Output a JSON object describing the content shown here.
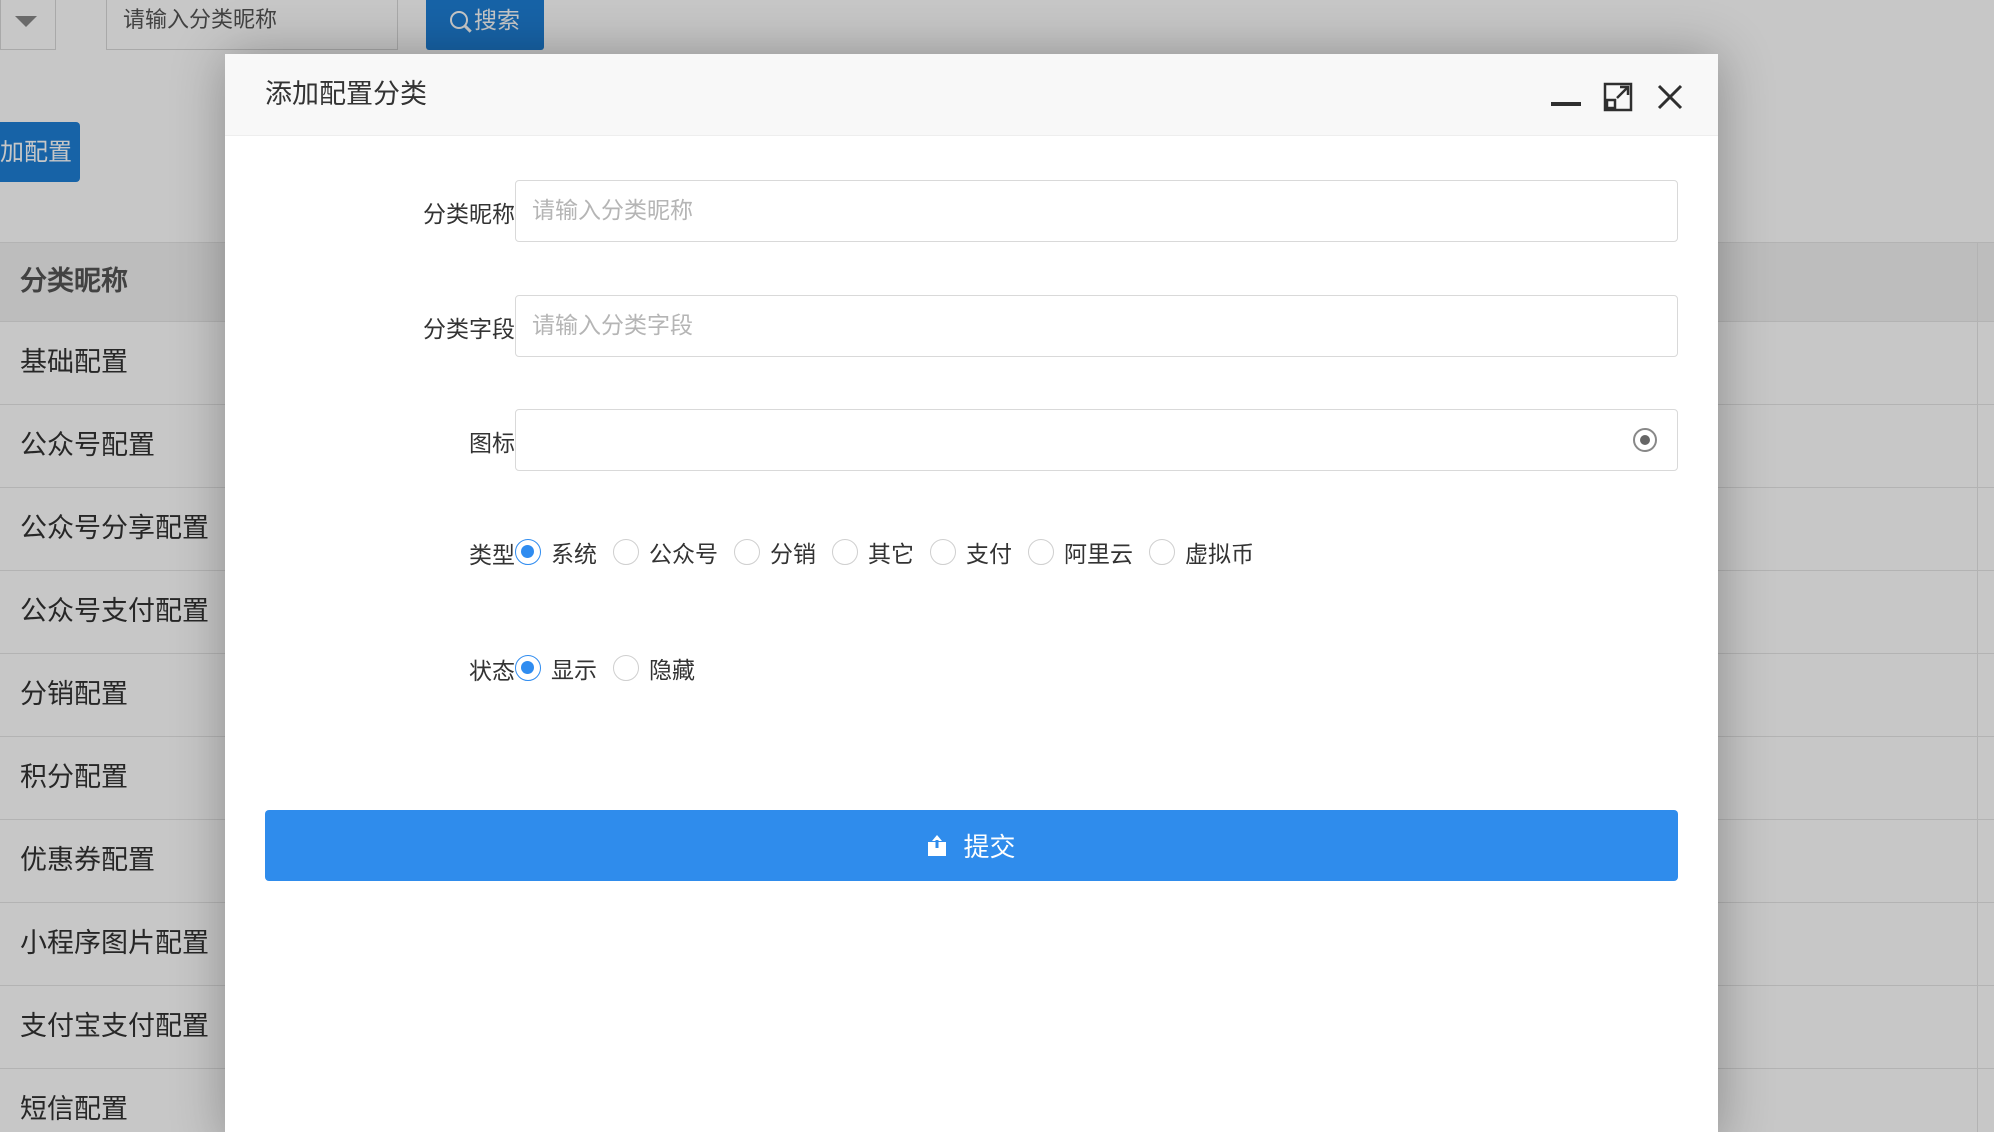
{
  "background": {
    "search_placeholder": "请输入分类昵称",
    "search_button": "搜索",
    "add_button": "加配置",
    "table": {
      "header": "分类昵称",
      "rows": [
        "基础配置",
        "公众号配置",
        "公众号分享配置",
        "公众号支付配置",
        "分销配置",
        "积分配置",
        "优惠券配置",
        "小程序图片配置",
        "支付宝支付配置",
        "短信配置"
      ]
    }
  },
  "dialog": {
    "title": "添加配置分类",
    "fields": {
      "name": {
        "label": "分类昵称",
        "placeholder": "请输入分类昵称",
        "value": ""
      },
      "field": {
        "label": "分类字段",
        "placeholder": "请输入分类字段",
        "value": ""
      },
      "icon": {
        "label": "图标",
        "value": ""
      }
    },
    "type": {
      "label": "类型",
      "options": [
        "系统",
        "公众号",
        "分销",
        "其它",
        "支付",
        "阿里云",
        "虚拟币"
      ],
      "selected": "系统"
    },
    "status": {
      "label": "状态",
      "options": [
        "显示",
        "隐藏"
      ],
      "selected": "显示"
    },
    "submit_label": "提交"
  },
  "colors": {
    "primary": "#2f8cec",
    "bg_button": "#1e7fd6"
  }
}
